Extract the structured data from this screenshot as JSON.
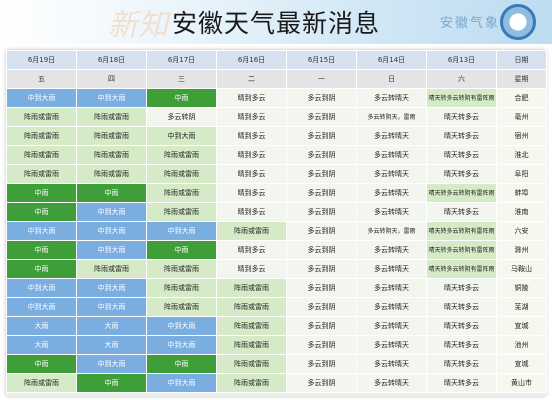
{
  "banner": {
    "title": "安徽天气最新消息",
    "logo_text": "安徽气象",
    "watermark_text": "新知"
  },
  "colors": {
    "none": "#f3f6ee",
    "mid": "#d5ebc8",
    "green": "#3e9f39",
    "blue": "#7aaee0"
  },
  "table": {
    "dates": [
      "6月19日",
      "6月18日",
      "6月17日",
      "6月16日",
      "6月15日",
      "6月14日",
      "6月13日",
      "日期"
    ],
    "weekdays": [
      "五",
      "四",
      "三",
      "二",
      "一",
      "日",
      "六",
      "星期"
    ],
    "rows": [
      {
        "city": "合肥",
        "cells": [
          {
            "t": "中到大雨",
            "c": "blue"
          },
          {
            "t": "中到大雨",
            "c": "blue"
          },
          {
            "t": "中雨",
            "c": "green"
          },
          {
            "t": "晴到多云",
            "c": "none"
          },
          {
            "t": "多云到阴",
            "c": "none"
          },
          {
            "t": "多云转晴天",
            "c": "none"
          },
          {
            "t": "晴天转多云转阴有雷阵雨",
            "c": "mid"
          }
        ]
      },
      {
        "city": "亳州",
        "cells": [
          {
            "t": "阵雨或雷雨",
            "c": "mid"
          },
          {
            "t": "阵雨或雷雨",
            "c": "mid"
          },
          {
            "t": "多云转阴",
            "c": "none"
          },
          {
            "t": "晴到多云",
            "c": "none"
          },
          {
            "t": "多云到阴",
            "c": "none"
          },
          {
            "t": "多云转阴天，雷雨",
            "c": "none"
          },
          {
            "t": "晴天转多云",
            "c": "none"
          }
        ]
      },
      {
        "city": "宿州",
        "cells": [
          {
            "t": "阵雨或雷雨",
            "c": "mid"
          },
          {
            "t": "阵雨或雷雨",
            "c": "mid"
          },
          {
            "t": "中到大雨",
            "c": "mid"
          },
          {
            "t": "晴到多云",
            "c": "none"
          },
          {
            "t": "多云到阴",
            "c": "none"
          },
          {
            "t": "多云转晴天",
            "c": "none"
          },
          {
            "t": "晴天转多云",
            "c": "none"
          }
        ]
      },
      {
        "city": "淮北",
        "cells": [
          {
            "t": "阵雨或雷雨",
            "c": "mid"
          },
          {
            "t": "阵雨或雷雨",
            "c": "mid"
          },
          {
            "t": "阵雨或雷雨",
            "c": "mid"
          },
          {
            "t": "晴到多云",
            "c": "none"
          },
          {
            "t": "多云到阴",
            "c": "none"
          },
          {
            "t": "多云转晴天",
            "c": "none"
          },
          {
            "t": "晴天转多云",
            "c": "none"
          }
        ]
      },
      {
        "city": "阜阳",
        "cells": [
          {
            "t": "阵雨或雷雨",
            "c": "mid"
          },
          {
            "t": "阵雨或雷雨",
            "c": "mid"
          },
          {
            "t": "阵雨或雷雨",
            "c": "mid"
          },
          {
            "t": "晴到多云",
            "c": "none"
          },
          {
            "t": "多云到阴",
            "c": "none"
          },
          {
            "t": "多云转晴天",
            "c": "none"
          },
          {
            "t": "晴天转多云",
            "c": "none"
          }
        ]
      },
      {
        "city": "蚌埠",
        "cells": [
          {
            "t": "中雨",
            "c": "green"
          },
          {
            "t": "中雨",
            "c": "green"
          },
          {
            "t": "阵雨或雷雨",
            "c": "mid"
          },
          {
            "t": "晴到多云",
            "c": "none"
          },
          {
            "t": "多云到阴",
            "c": "none"
          },
          {
            "t": "多云转晴天",
            "c": "none"
          },
          {
            "t": "晴天转多云转阴有雷阵雨",
            "c": "mid"
          }
        ]
      },
      {
        "city": "淮南",
        "cells": [
          {
            "t": "中雨",
            "c": "green"
          },
          {
            "t": "中到大雨",
            "c": "blue"
          },
          {
            "t": "阵雨或雷雨",
            "c": "mid"
          },
          {
            "t": "晴到多云",
            "c": "none"
          },
          {
            "t": "多云到阴",
            "c": "none"
          },
          {
            "t": "多云转晴天",
            "c": "none"
          },
          {
            "t": "晴天转多云",
            "c": "none"
          }
        ]
      },
      {
        "city": "六安",
        "cells": [
          {
            "t": "中到大雨",
            "c": "blue"
          },
          {
            "t": "中到大雨",
            "c": "blue"
          },
          {
            "t": "中到大雨",
            "c": "blue"
          },
          {
            "t": "阵雨或雷雨",
            "c": "mid"
          },
          {
            "t": "多云到阴",
            "c": "none"
          },
          {
            "t": "多云转阴天，雷雨",
            "c": "none"
          },
          {
            "t": "晴天转多云转阴有雷阵雨",
            "c": "mid"
          }
        ]
      },
      {
        "city": "滁州",
        "cells": [
          {
            "t": "中雨",
            "c": "green"
          },
          {
            "t": "中到大雨",
            "c": "blue"
          },
          {
            "t": "中雨",
            "c": "green"
          },
          {
            "t": "晴到多云",
            "c": "none"
          },
          {
            "t": "多云到阴",
            "c": "none"
          },
          {
            "t": "多云转晴天",
            "c": "none"
          },
          {
            "t": "晴天转多云转阴有雷阵雨",
            "c": "mid"
          }
        ]
      },
      {
        "city": "马鞍山",
        "cells": [
          {
            "t": "中雨",
            "c": "green"
          },
          {
            "t": "阵雨或雷雨",
            "c": "mid"
          },
          {
            "t": "阵雨或雷雨",
            "c": "mid"
          },
          {
            "t": "晴到多云",
            "c": "none"
          },
          {
            "t": "多云到阴",
            "c": "none"
          },
          {
            "t": "多云转晴天",
            "c": "none"
          },
          {
            "t": "晴天转多云转阴有雷阵雨",
            "c": "mid"
          }
        ]
      },
      {
        "city": "铜陵",
        "cells": [
          {
            "t": "中到大雨",
            "c": "blue"
          },
          {
            "t": "中到大雨",
            "c": "blue"
          },
          {
            "t": "阵雨或雷雨",
            "c": "mid"
          },
          {
            "t": "阵雨或雷雨",
            "c": "mid"
          },
          {
            "t": "多云到阴",
            "c": "none"
          },
          {
            "t": "多云转晴天",
            "c": "none"
          },
          {
            "t": "晴天转多云",
            "c": "none"
          }
        ]
      },
      {
        "city": "芜湖",
        "cells": [
          {
            "t": "中到大雨",
            "c": "blue"
          },
          {
            "t": "中到大雨",
            "c": "blue"
          },
          {
            "t": "阵雨或雷雨",
            "c": "mid"
          },
          {
            "t": "阵雨或雷雨",
            "c": "mid"
          },
          {
            "t": "多云到阴",
            "c": "none"
          },
          {
            "t": "多云转晴天",
            "c": "none"
          },
          {
            "t": "晴天转多云",
            "c": "none"
          }
        ]
      },
      {
        "city": "宣城",
        "cells": [
          {
            "t": "大雨",
            "c": "blue"
          },
          {
            "t": "大雨",
            "c": "blue"
          },
          {
            "t": "中到大雨",
            "c": "blue"
          },
          {
            "t": "阵雨或雷雨",
            "c": "mid"
          },
          {
            "t": "多云到阴",
            "c": "none"
          },
          {
            "t": "多云转晴天",
            "c": "none"
          },
          {
            "t": "晴天转多云",
            "c": "none"
          }
        ]
      },
      {
        "city": "池州",
        "cells": [
          {
            "t": "大雨",
            "c": "blue"
          },
          {
            "t": "大雨",
            "c": "blue"
          },
          {
            "t": "中到大雨",
            "c": "blue"
          },
          {
            "t": "阵雨或雷雨",
            "c": "mid"
          },
          {
            "t": "多云到阴",
            "c": "none"
          },
          {
            "t": "多云转晴天",
            "c": "none"
          },
          {
            "t": "晴天转多云",
            "c": "none"
          }
        ]
      },
      {
        "city": "宣城",
        "cells": [
          {
            "t": "中雨",
            "c": "green"
          },
          {
            "t": "中到大雨",
            "c": "blue"
          },
          {
            "t": "中雨",
            "c": "green"
          },
          {
            "t": "阵雨或雷雨",
            "c": "mid"
          },
          {
            "t": "多云到阴",
            "c": "none"
          },
          {
            "t": "多云转晴天",
            "c": "none"
          },
          {
            "t": "晴天转多云",
            "c": "none"
          }
        ]
      },
      {
        "city": "黄山市",
        "cells": [
          {
            "t": "阵雨或雷雨",
            "c": "mid"
          },
          {
            "t": "中雨",
            "c": "green"
          },
          {
            "t": "中到大雨",
            "c": "blue"
          },
          {
            "t": "阵雨或雷雨",
            "c": "mid"
          },
          {
            "t": "多云到阴",
            "c": "none"
          },
          {
            "t": "多云转晴天",
            "c": "none"
          },
          {
            "t": "晴天转多云",
            "c": "none"
          }
        ]
      }
    ]
  }
}
